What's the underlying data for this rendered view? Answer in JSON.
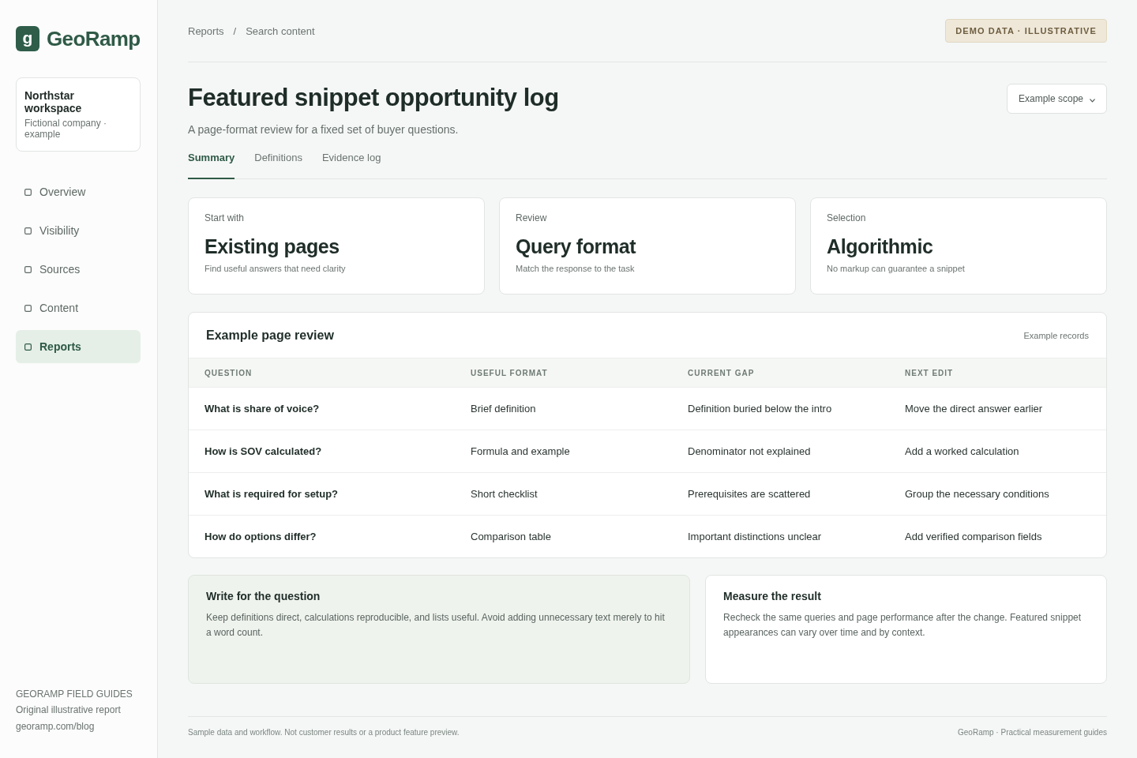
{
  "sidebar": {
    "logo": {
      "mark": "g",
      "name": "GeoRamp"
    },
    "workspace": {
      "name": "Northstar workspace",
      "note": "Fictional company · example"
    },
    "nav": [
      {
        "label": "Overview",
        "selected": false
      },
      {
        "label": "Visibility",
        "selected": false
      },
      {
        "label": "Sources",
        "selected": false
      },
      {
        "label": "Content",
        "selected": false
      },
      {
        "label": "Reports",
        "selected": true
      }
    ],
    "footer": {
      "heading": "GEORAMP FIELD GUIDES",
      "note": "Original illustrative report",
      "link": "georamp.com/blog"
    }
  },
  "breadcrumb": {
    "items": [
      "Reports",
      "Search content"
    ],
    "separator": "/"
  },
  "badge": "DEMO DATA · ILLUSTRATIVE",
  "header": {
    "title": "Featured snippet opportunity log",
    "subtitle": "A page-format review for a fixed set of buyer questions.",
    "scope_button": "Example scope"
  },
  "tabs": [
    {
      "label": "Summary",
      "selected": true
    },
    {
      "label": "Definitions",
      "selected": false
    },
    {
      "label": "Evidence log",
      "selected": false
    }
  ],
  "summary_cards": [
    {
      "label": "Start with",
      "value": "Existing pages",
      "note": "Find useful answers that need clarity"
    },
    {
      "label": "Review",
      "value": "Query format",
      "note": "Match the response to the task"
    },
    {
      "label": "Selection",
      "value": "Algorithmic",
      "note": "No markup can guarantee a snippet"
    }
  ],
  "review": {
    "title": "Example page review",
    "note": "Example records",
    "columns": [
      "QUESTION",
      "USEFUL FORMAT",
      "CURRENT GAP",
      "NEXT EDIT"
    ],
    "rows": [
      [
        "What is share of voice?",
        "Brief definition",
        "Definition buried below the intro",
        "Move the direct answer earlier"
      ],
      [
        "How is SOV calculated?",
        "Formula and example",
        "Denominator not explained",
        "Add a worked calculation"
      ],
      [
        "What is required for setup?",
        "Short checklist",
        "Prerequisites are scattered",
        "Group the necessary conditions"
      ],
      [
        "How do options differ?",
        "Comparison table",
        "Important distinctions unclear",
        "Add verified comparison fields"
      ]
    ]
  },
  "notes": [
    {
      "kind": "tinted",
      "title": "Write for the question",
      "body": "Keep definitions direct, calculations reproducible, and lists useful. Avoid adding unnecessary text merely to hit a word count."
    },
    {
      "kind": "plain",
      "title": "Measure the result",
      "body": "Recheck the same queries and page performance after the change. Featured snippet appearances can vary over time and by context."
    }
  ],
  "footer": {
    "left": "Sample data and workflow. Not customer results or a product feature preview.",
    "right": "GeoRamp · Practical measurement guides"
  }
}
